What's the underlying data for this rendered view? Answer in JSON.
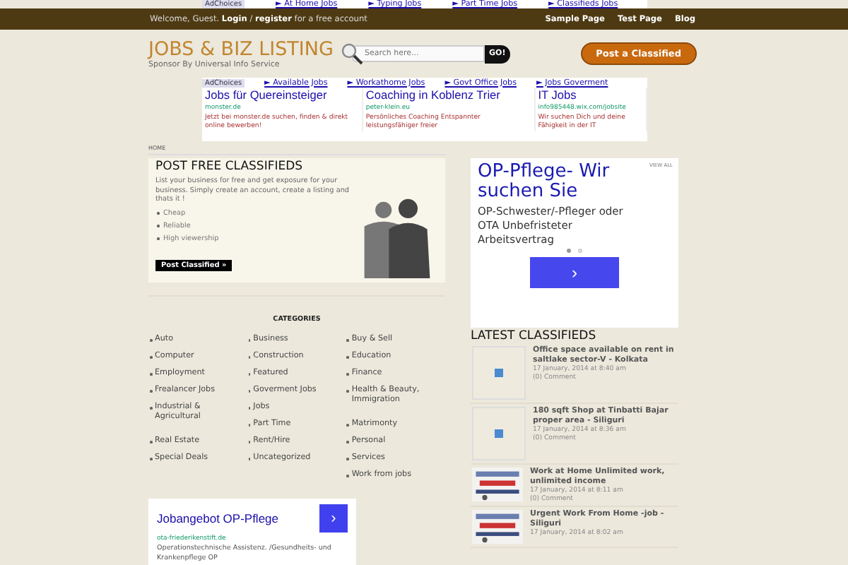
{
  "top_ad": {
    "adchoices": "AdChoices",
    "links": [
      "► At Home Jobs",
      "► Typing Jobs",
      "► Part Time Jobs",
      "► Classifieds Jobs"
    ]
  },
  "topbar": {
    "welcome": "Welcome, Guest. **Login** / **register** for a free account",
    "nav": [
      "Sample Page",
      "Test Page",
      "Blog"
    ]
  },
  "header": {
    "logo": "JOBS & BIZ LISTING",
    "tagline": "Sponsor By Universal Info Service",
    "search": {
      "placeholder": "Search here...",
      "button": "GO!"
    },
    "post_button": "Post a Classified"
  },
  "ad_block": {
    "adchoices": "AdChoices",
    "links": [
      "► Available Jobs",
      "► Workathome Jobs",
      "► Govt Office Jobs",
      "► Jobs Goverment"
    ],
    "ads": [
      {
        "title": "Jobs für Quereinsteiger",
        "url": "monster.de",
        "text": "Jetzt bei monster.de suchen, finden & direkt online bewerben!"
      },
      {
        "title": "Coaching in Koblenz Trier",
        "url": "peter-klein.eu",
        "text": "Persönliches Coaching Entspannter leistungsfähiger freier"
      },
      {
        "title": "IT Jobs",
        "url": "info985448.wix.com/jobsite",
        "text": "Wir suchen Dich und deine Fähigkeit in der IT"
      }
    ]
  },
  "breadcrumb": "HOME",
  "promo": {
    "title": "POST FREE CLASSIFIEDS",
    "text": "List your business for free and get exposure for your business. Simply create an account, create a listing and thats it !",
    "bullets": [
      "Cheap",
      "Reliable",
      "High viewership"
    ],
    "button": "Post Classified »"
  },
  "categories": {
    "title": "CATEGORIES",
    "columns": [
      [
        "Auto",
        "Computer",
        "Employment",
        "Frealancer Jobs",
        "Industrial & Agricultural",
        "Real Estate",
        "Special Deals"
      ],
      [
        "Business",
        "Construction",
        "Featured",
        "Goverment Jobs",
        "Jobs",
        "Part Time",
        "Rent/Hire",
        "Uncategorized"
      ],
      [
        "Buy & Sell",
        "Education",
        "Finance",
        "Health & Beauty, Immigration",
        "Matrimonty",
        "Personal",
        "Services",
        "Work from jobs"
      ]
    ]
  },
  "bottom_ad": {
    "title": "Jobangebot OP-Pflege",
    "button": "›",
    "url": "ota-friederikenstift.de",
    "text": "Operationstechnische Assistenz. /Gesundheits- und Krankenpflege OP"
  },
  "side_ad": {
    "view_all": "VIEW ALL",
    "title": "OP-Pflege- Wir suchen Sie",
    "text": "OP-Schwester/-Pfleger oder OTA Unbefristeter Arbeitsvertrag",
    "dots": [
      {
        "selected": true
      },
      {
        "selected": false
      }
    ],
    "button": "›"
  },
  "latest": {
    "title": "LATEST CLASSIFIEDS",
    "items": [
      {
        "kind": "placeholder",
        "title": "Office space available on rent in saltlake sector-V - Kolkata",
        "date": "17 January, 2014 at 8:40 am",
        "comments": "(0) Comment"
      },
      {
        "kind": "placeholder",
        "title": "180 sqft Shop at Tinbatti Bajar proper area - Siliguri",
        "date": "17 January, 2014 at 8:36 am",
        "comments": "(0) Comment"
      },
      {
        "kind": "picture",
        "title": "Work at Home Unlimited work, unlimited income",
        "date": "17 January, 2014 at 8:11 am",
        "comments": "(0) Comment"
      },
      {
        "kind": "picture",
        "title": "Urgent Work From Home -job - Siliguri",
        "date": "17 January, 2014 at 8:02 am"
      }
    ]
  }
}
